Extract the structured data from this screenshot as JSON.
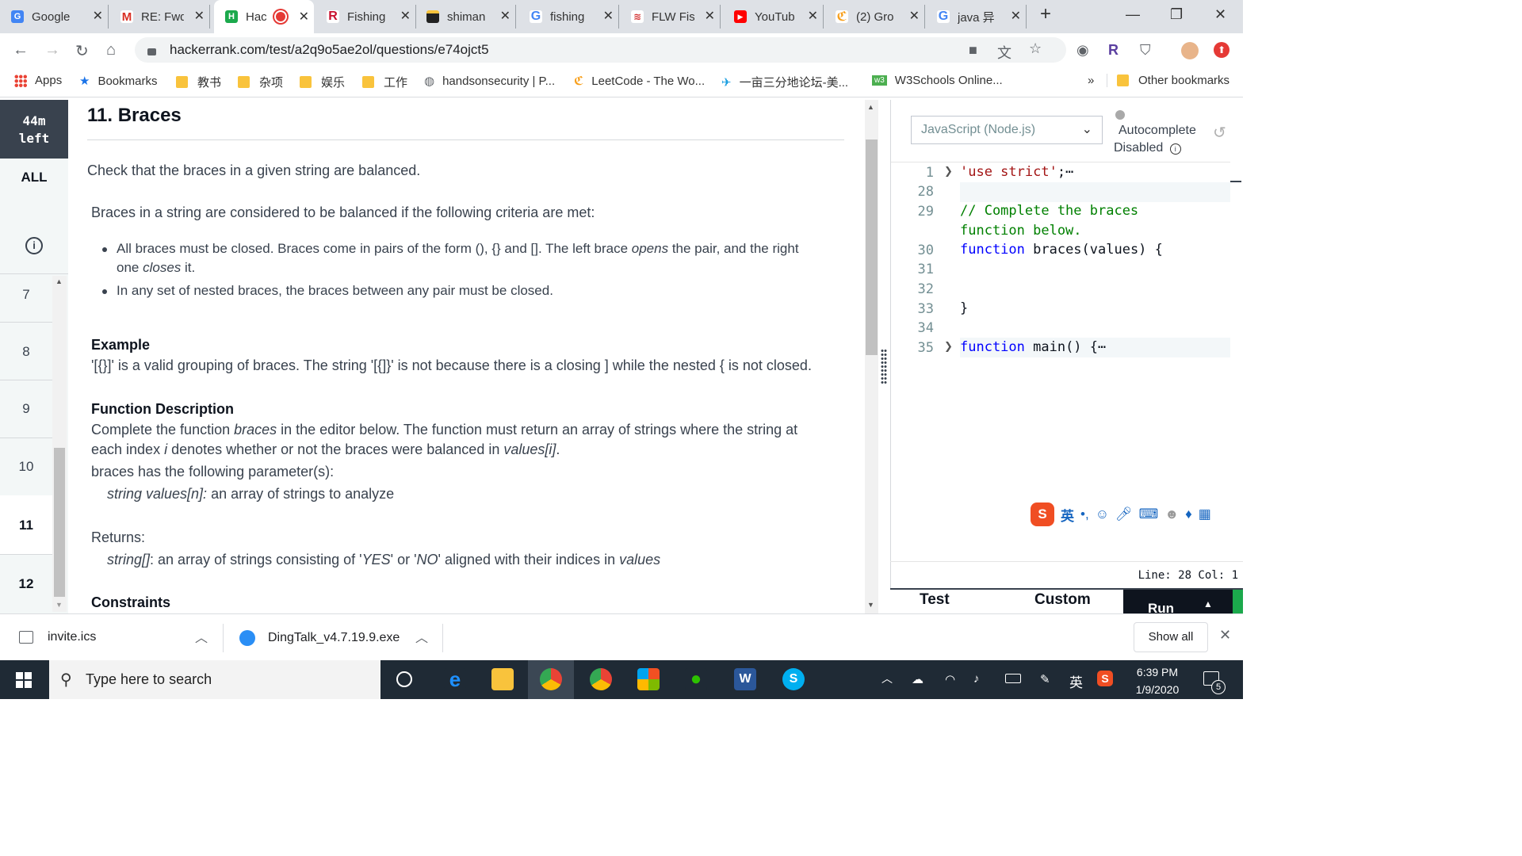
{
  "browser": {
    "tabs": [
      {
        "title": "Google",
        "icon": "google-docs-icon",
        "color": "#4285f4"
      },
      {
        "title": "RE: Fwd",
        "icon": "gmail-icon",
        "color": "#d93025"
      },
      {
        "title": "Hac",
        "icon": "hackerrank-icon",
        "color": "#1ba94c",
        "active": true
      },
      {
        "title": "Fishing",
        "icon": "r-icon",
        "color": "#c8102e"
      },
      {
        "title": "shiman",
        "icon": "shop-icon",
        "color": "#222222"
      },
      {
        "title": "fishing",
        "icon": "google-icon",
        "color": "#4285f4"
      },
      {
        "title": "FLW Fis",
        "icon": "flw-icon",
        "color": "#d32f2f"
      },
      {
        "title": "YouTub",
        "icon": "youtube-icon",
        "color": "#ff0000"
      },
      {
        "title": "(2) Gro",
        "icon": "leetcode-icon",
        "color": "#f89f1b"
      },
      {
        "title": "java 异",
        "icon": "google-icon",
        "color": "#4285f4"
      }
    ],
    "url": "hackerrank.com/test/a2q9o5ae2ol/questions/e74ojct5",
    "bookmarks": [
      {
        "label": "Apps",
        "icon": "apps-icon"
      },
      {
        "label": "Bookmarks",
        "icon": "star-icon"
      },
      {
        "label": "教书",
        "icon": "folder-icon"
      },
      {
        "label": "杂项",
        "icon": "folder-icon"
      },
      {
        "label": "娱乐",
        "icon": "folder-icon"
      },
      {
        "label": "工作",
        "icon": "folder-icon"
      },
      {
        "label": "handsonsecurity | P...",
        "icon": "globe-icon"
      },
      {
        "label": "LeetCode - The Wo...",
        "icon": "leetcode-icon"
      },
      {
        "label": "一亩三分地论坛-美...",
        "icon": "site-icon"
      },
      {
        "label": "W3Schools Online...",
        "icon": "w3-icon"
      }
    ],
    "more_bookmarks": "»",
    "other_bookmarks": "Other bookmarks"
  },
  "sidebar": {
    "time_value": "44m",
    "time_label": "left",
    "all_label": "ALL",
    "questions": [
      "7",
      "8",
      "9",
      "10",
      "11",
      "12"
    ],
    "current": "11"
  },
  "problem": {
    "title": "11. Braces",
    "intro": "Check that the braces in a given string are balanced.",
    "criteria_intro": "Braces in a string are considered to be balanced if the following criteria are met:",
    "bullet1_pre": "All braces must be closed. Braces come in pairs of the form (), {} and [].  The left brace ",
    "bullet1_em1": "opens",
    "bullet1_mid": " the pair, and the right one ",
    "bullet1_em2": "closes",
    "bullet1_post": " it.",
    "bullet2": "In any set of nested braces, the braces between any pair must be closed.",
    "example_heading": "Example",
    "example_text": "'[{}]' is a valid grouping of braces. The string '[{]}' is not because there is a closing ] while the nested { is not closed.",
    "fd_heading": "Function Description",
    "fd_pre": "Complete the function ",
    "fd_em1": "braces",
    "fd_mid": " in the editor below. The function must return an array of strings where the string at each index ",
    "fd_em2": "i",
    "fd_mid2": " denotes whether or not the braces were balanced in ",
    "fd_em3": "values[i]",
    "fd_post": ".",
    "params_intro": "braces has the following parameter(s):",
    "param_name": "string values[n]:",
    "param_desc": "  an array of strings to analyze",
    "returns_heading": "Returns:",
    "returns_type": "string[]",
    "returns_pre": ": an array of strings consisting of '",
    "returns_yes": "YES",
    "returns_or": "' or '",
    "returns_no": "NO",
    "returns_post": "' aligned with their indices in ",
    "returns_values": "values",
    "constraints_heading": "Constraints"
  },
  "editor": {
    "language": "JavaScript (Node.js)",
    "autocomplete_line1": "Autocomplete",
    "autocomplete_line2": "Disabled",
    "lines": [
      {
        "n": "1",
        "str": "'use strict'",
        "rest": ";⋯"
      },
      {
        "n": "28"
      },
      {
        "n": "29",
        "comment": "// Complete the braces"
      },
      {
        "n": "",
        "comment": "function below."
      },
      {
        "n": "30",
        "kw": "function",
        "rest": " braces(values) {"
      },
      {
        "n": "31"
      },
      {
        "n": "32"
      },
      {
        "n": "33",
        "rest": "}"
      },
      {
        "n": "34"
      },
      {
        "n": "35",
        "kw": "function",
        "rest": " main() {⋯"
      }
    ],
    "status": "Line: 28 Col: 1",
    "test_tab": "Test",
    "custom_tab": "Custom",
    "run_button": "Run"
  },
  "ime": {
    "label": "英"
  },
  "downloads": {
    "items": [
      {
        "name": "invite.ics",
        "icon": "calendar-file-icon"
      },
      {
        "name": "DingTalk_v4.7.19.9.exe",
        "icon": "dingtalk-icon"
      }
    ],
    "show_all": "Show all"
  },
  "taskbar": {
    "search_placeholder": "Type here to search",
    "time": "6:39 PM",
    "date": "1/9/2020",
    "lang": "英",
    "notifications": "5"
  }
}
